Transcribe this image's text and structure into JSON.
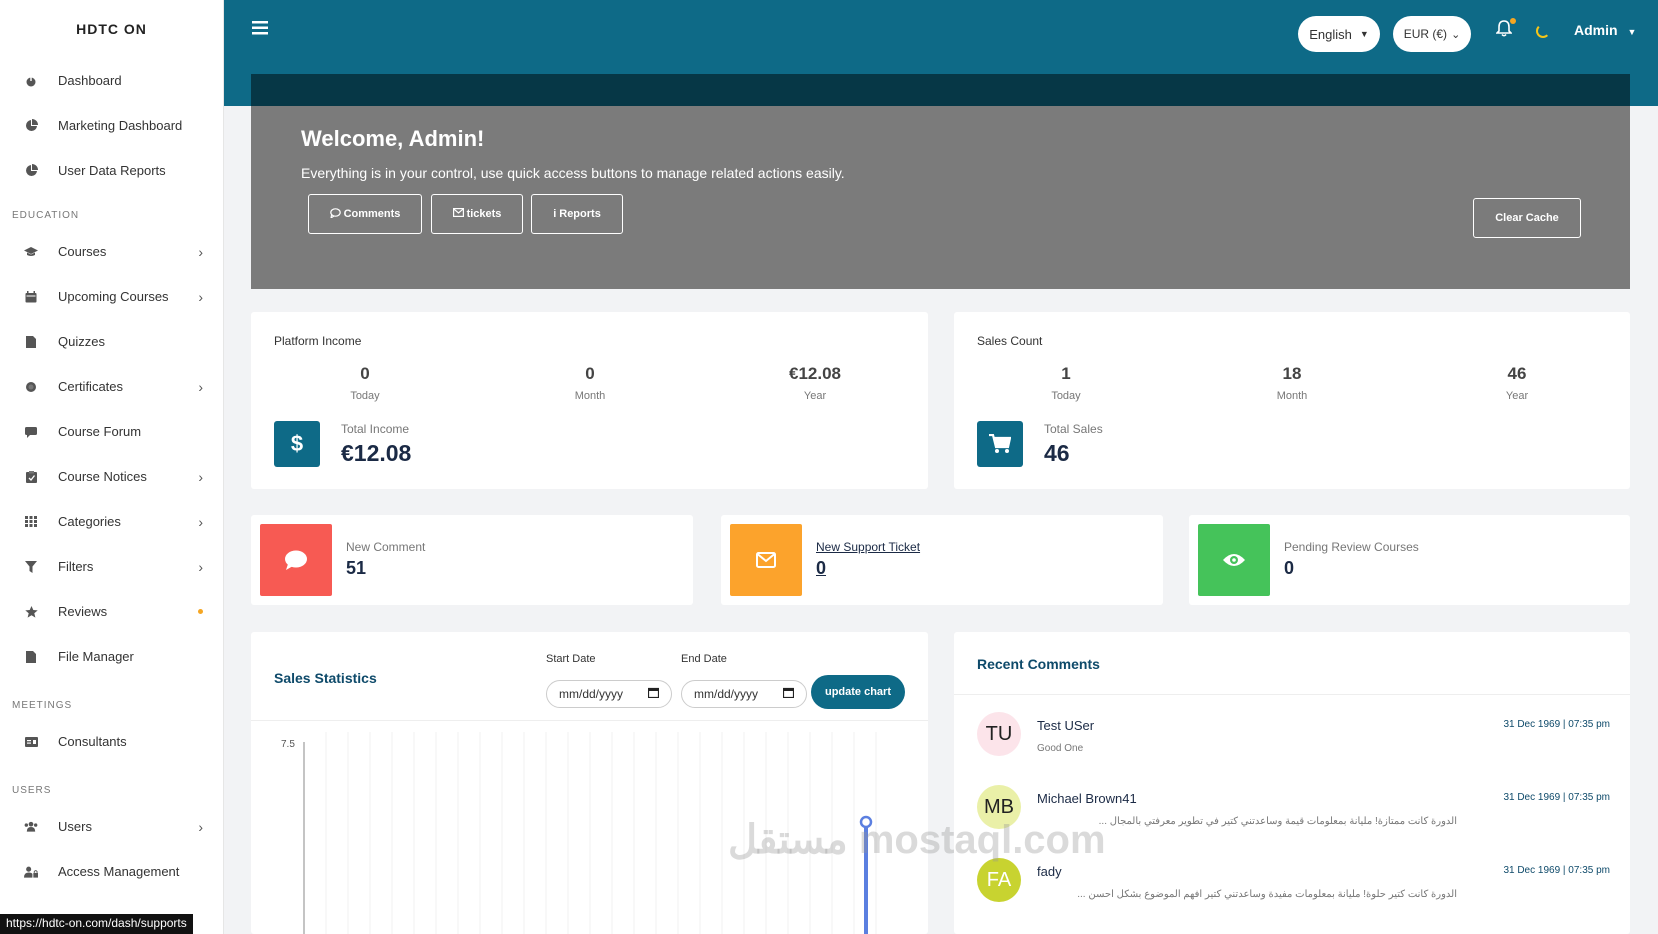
{
  "brand": "HDTC ON",
  "sidebar": {
    "items_top": [
      {
        "label": "Dashboard",
        "icon": "dashboard-icon"
      },
      {
        "label": "Marketing Dashboard",
        "icon": "pie-chart-icon"
      },
      {
        "label": "User Data Reports",
        "icon": "pie-chart-icon"
      }
    ],
    "education_label": "EDUCATION",
    "education_items": [
      {
        "label": "Courses",
        "icon": "graduation-cap-icon",
        "chevron": true
      },
      {
        "label": "Upcoming Courses",
        "icon": "calendar-icon",
        "chevron": true
      },
      {
        "label": "Quizzes",
        "icon": "file-icon",
        "chevron": false
      },
      {
        "label": "Certificates",
        "icon": "certificate-icon",
        "chevron": true
      },
      {
        "label": "Course Forum",
        "icon": "comment-icon",
        "chevron": false
      },
      {
        "label": "Course Notices",
        "icon": "clipboard-icon",
        "chevron": true
      },
      {
        "label": "Categories",
        "icon": "grid-icon",
        "chevron": true
      },
      {
        "label": "Filters",
        "icon": "filter-icon",
        "chevron": true
      },
      {
        "label": "Reviews",
        "icon": "star-icon",
        "chevron": false
      },
      {
        "label": "File Manager",
        "icon": "file-icon",
        "chevron": false
      }
    ],
    "meetings_label": "MEETINGS",
    "meetings_items": [
      {
        "label": "Consultants",
        "icon": "id-card-icon"
      }
    ],
    "users_label": "USERS",
    "users_items": [
      {
        "label": "Users",
        "icon": "users-icon",
        "chevron": true
      },
      {
        "label": "Access Management",
        "icon": "user-lock-icon",
        "chevron": false
      }
    ]
  },
  "topbar": {
    "language": "English",
    "currency": "EUR (€)",
    "user": "Admin"
  },
  "welcome": {
    "title": "Welcome, Admin!",
    "subtitle": "Everything is in your control, use quick access buttons to manage related actions easily.",
    "buttons": [
      "Comments",
      "tickets",
      "Reports"
    ],
    "clear_cache": "Clear Cache"
  },
  "income": {
    "title": "Platform Income",
    "today": "0",
    "today_label": "Today",
    "month": "0",
    "month_label": "Month",
    "year": "€12.08",
    "year_label": "Year",
    "total_label": "Total Income",
    "total_value": "€12.08"
  },
  "sales": {
    "title": "Sales Count",
    "today": "1",
    "today_label": "Today",
    "month": "18",
    "month_label": "Month",
    "year": "46",
    "year_label": "Year",
    "total_label": "Total Sales",
    "total_value": "46"
  },
  "mini": {
    "comment_label": "New Comment",
    "comment_value": "51",
    "ticket_label": "New Support Ticket",
    "ticket_value": "0",
    "pending_label": "Pending Review Courses",
    "pending_value": "0"
  },
  "colors": {
    "primary": "#0e6a87",
    "comment": "#f75a53",
    "ticket": "#fca32c",
    "pending": "#45c35a"
  },
  "statistics": {
    "title": "Sales Statistics",
    "start_label": "Start Date",
    "end_label": "End Date",
    "date_placeholder": "mm/dd/yyyy",
    "update_label": "update chart",
    "y_tick": "7.5"
  },
  "comments": {
    "title": "Recent Comments",
    "items": [
      {
        "initials": "TU",
        "name": "Test USer",
        "text": "Good One",
        "date": "31 Dec 1969 | 07:35 pm",
        "bg": "#fce4ea"
      },
      {
        "initials": "MB",
        "name": "Michael Brown41",
        "text": "الدورة كانت ممتازة! مليانة بمعلومات قيمة وساعدتني كتير في تطوير معرفتي بالمجال ...",
        "date": "31 Dec 1969 | 07:35 pm",
        "bg": "#eaf0a8"
      },
      {
        "initials": "FA",
        "name": "fady",
        "text": "الدورة كانت كتير حلوة! مليانة بمعلومات مفيدة وساعدتني كتير أفهم الموضوع بشكل أحسن ...",
        "date": "31 Dec 1969 | 07:35 pm",
        "bg": "#c8d330"
      }
    ]
  },
  "status_url": "https://hdtc-on.com/dash/supports",
  "watermark": "مستقل mostaql.com"
}
